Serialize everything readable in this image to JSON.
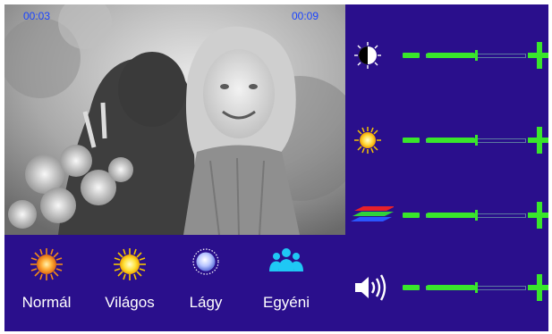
{
  "video": {
    "elapsed": "00:03",
    "total": "00:09"
  },
  "modes": [
    {
      "label": "Normál",
      "icon": "sun-orange-icon"
    },
    {
      "label": "Világos",
      "icon": "sun-yellow-icon"
    },
    {
      "label": "Lágy",
      "icon": "soft-light-icon"
    },
    {
      "label": "Egyéni",
      "icon": "users-icon"
    }
  ],
  "controls": [
    {
      "name": "brightness",
      "icon": "contrast-icon",
      "level": 0.5
    },
    {
      "name": "color",
      "icon": "sun-icon",
      "level": 0.5
    },
    {
      "name": "saturation",
      "icon": "rgb-layers-icon",
      "level": 0.5
    },
    {
      "name": "volume",
      "icon": "speaker-icon",
      "level": 0.5
    }
  ],
  "colors": {
    "background": "#2a0f8c",
    "accent": "#39e62b",
    "timer": "#1a44ff"
  }
}
